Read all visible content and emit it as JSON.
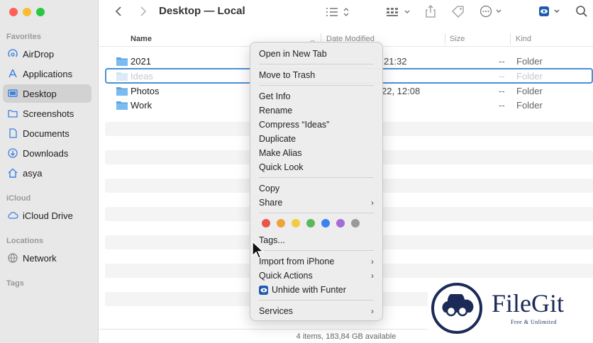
{
  "window": {
    "title": "Desktop — Local"
  },
  "sidebar": {
    "sections": [
      {
        "label": "Favorites"
      },
      {
        "label": "iCloud"
      },
      {
        "label": "Locations"
      },
      {
        "label": "Tags"
      }
    ],
    "items": [
      {
        "label": "AirDrop",
        "icon": "airdrop-icon"
      },
      {
        "label": "Applications",
        "icon": "applications-icon"
      },
      {
        "label": "Desktop",
        "icon": "desktop-icon",
        "selected": true
      },
      {
        "label": "Screenshots",
        "icon": "folder-icon"
      },
      {
        "label": "Documents",
        "icon": "document-icon"
      },
      {
        "label": "Downloads",
        "icon": "download-icon"
      },
      {
        "label": "asya",
        "icon": "home-icon"
      },
      {
        "label": "iCloud Drive",
        "icon": "cloud-icon"
      },
      {
        "label": "Network",
        "icon": "network-icon"
      }
    ]
  },
  "columns": {
    "name": "Name",
    "date": "Date Modified",
    "size": "Size",
    "kind": "Kind"
  },
  "files": [
    {
      "name": "2021",
      "date": "21:32",
      "size": "--",
      "kind": "Folder"
    },
    {
      "name": "Ideas",
      "date": "",
      "size": "--",
      "kind": "Folder",
      "renaming": true
    },
    {
      "name": "Photos",
      "date": "22, 12:08",
      "size": "--",
      "kind": "Folder"
    },
    {
      "name": "Work",
      "date": "",
      "size": "--",
      "kind": "Folder"
    }
  ],
  "status": "4 items, 183,84 GB available",
  "context_menu": {
    "items": [
      "Open in New Tab",
      "Move to Trash",
      "Get Info",
      "Rename",
      "Compress “Ideas”",
      "Duplicate",
      "Make Alias",
      "Quick Look",
      "Copy",
      "Share",
      "Tags...",
      "Import from iPhone",
      "Quick Actions",
      "Unhide with Funter",
      "Services"
    ],
    "tag_colors": [
      "#e9574a",
      "#f0a23a",
      "#f3cb43",
      "#5cb85c",
      "#3b82f0",
      "#a66bd6",
      "#9a9a9a"
    ]
  },
  "watermark": {
    "brand": "FileGit",
    "tagline": "Free & Unlimited"
  },
  "colors": {
    "accent": "#4a90d9",
    "folder": "#5ba3e0"
  }
}
